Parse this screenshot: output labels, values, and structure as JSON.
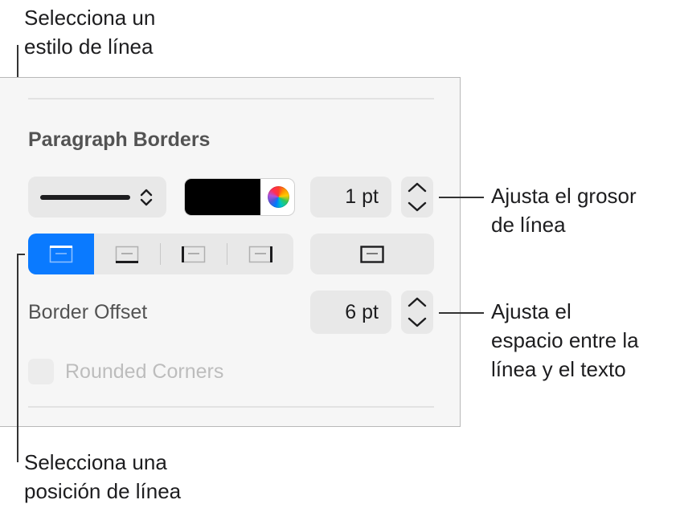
{
  "callouts": {
    "line_style": [
      "Selecciona un",
      "estilo de línea"
    ],
    "line_thickness": [
      "Ajusta el grosor",
      "de línea"
    ],
    "border_offset": [
      "Ajusta el",
      "espacio entre la",
      "línea y el texto"
    ],
    "line_position": [
      "Selecciona una",
      "posición de línea"
    ]
  },
  "panel": {
    "title": "Paragraph Borders",
    "line_style_control": {
      "selected": "solid-line"
    },
    "color": {
      "swatch": "#000000"
    },
    "thickness": {
      "value": "1 pt"
    },
    "position_segments": [
      "top-border",
      "bottom-border",
      "left-border",
      "right-border"
    ],
    "position_selected": "top-border",
    "all_borders_button": "box-border",
    "border_offset": {
      "label": "Border Offset",
      "value": "6 pt"
    },
    "rounded_corners": {
      "label": "Rounded Corners",
      "checked": false,
      "enabled": false
    }
  },
  "colors": {
    "accent": "#0a7aff",
    "panel_bg": "#f6f6f6",
    "control_bg": "#e8e8e8"
  }
}
